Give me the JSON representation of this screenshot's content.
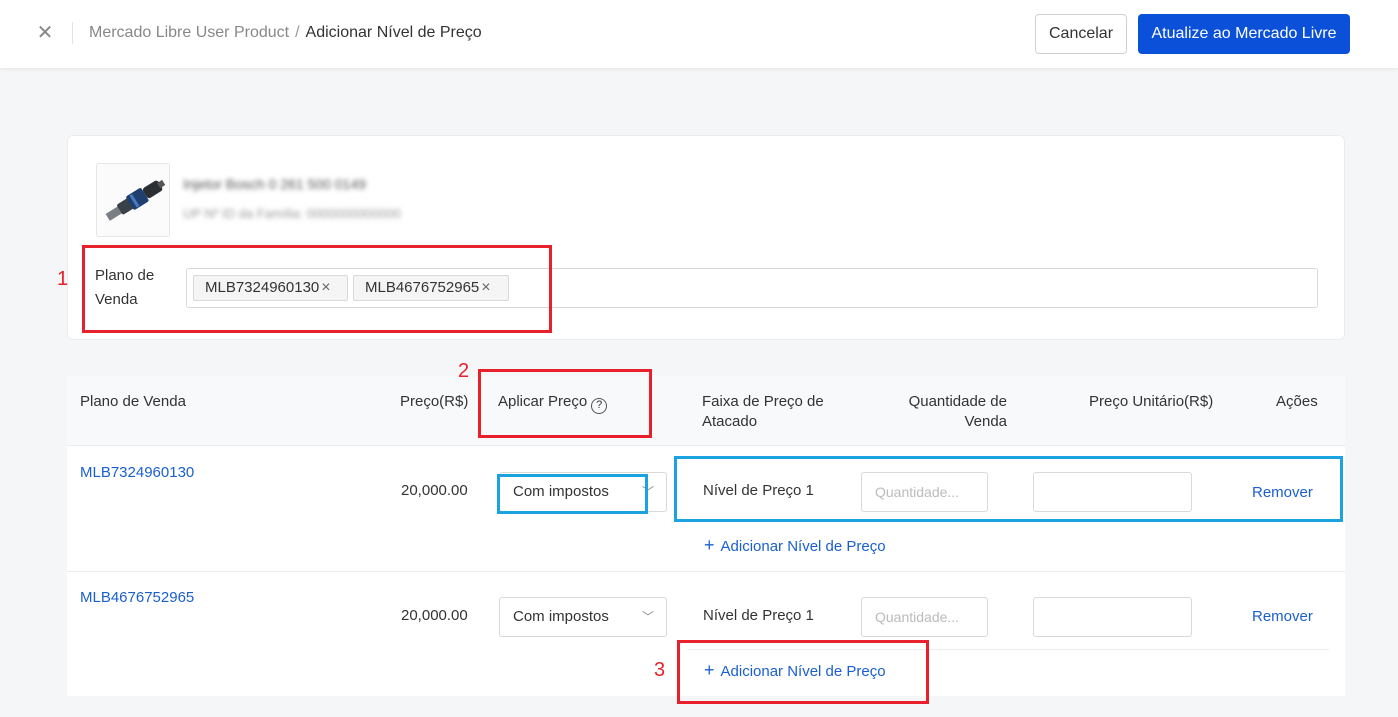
{
  "header": {
    "breadcrumb": [
      "Mercado Libre User Product",
      "Adicionar Nível de Preço"
    ],
    "cancel_label": "Cancelar",
    "submit_label": "Atualize ao Mercado Livre"
  },
  "product": {
    "title_blurred": "Injetor Bosch 0 261 500 0149",
    "subtitle_blurred": "UP Nº ID da Família: 0000000000000",
    "plan_label": "Plano de Venda",
    "plans": [
      {
        "label": "MLB7324960130"
      },
      {
        "label": "MLB4676752965"
      }
    ]
  },
  "table": {
    "headers": {
      "plan": "Plano de Venda",
      "price": "Preço(R$)",
      "apply": "Aplicar Preço",
      "range": "Faixa de Preço de Atacado",
      "qty": "Quantidade de Venda",
      "unit": "Preço Unitário(R$)",
      "actions": "Ações"
    },
    "help_glyph": "?",
    "rows": [
      {
        "plan": "MLB7324960130",
        "price": "20,000.00",
        "apply": "Com impostos",
        "level": "Nível de Preço 1",
        "qty_placeholder": "Quantidade...",
        "unit_price": "",
        "remove": "Remover",
        "add_level": "Adicionar Nível de Preço"
      },
      {
        "plan": "MLB4676752965",
        "price": "20,000.00",
        "apply": "Com impostos",
        "level": "Nível de Preço 1",
        "qty_placeholder": "Quantidade...",
        "unit_price": "",
        "remove": "Remover",
        "add_level": "Adicionar Nível de Preço"
      }
    ]
  },
  "annotations": {
    "n1": "1",
    "n2": "2",
    "n3": "3",
    "colors": {
      "red": "#e8202b",
      "blue": "#1aa3e0"
    }
  },
  "colors": {
    "primary": "#0b50d9",
    "link": "#1a5fd0"
  },
  "icons": {
    "close": "close-icon",
    "tag_remove": "tag-remove-icon",
    "chevron": "chevron-down-icon",
    "plus": "plus-icon",
    "help": "help-circle-icon"
  }
}
